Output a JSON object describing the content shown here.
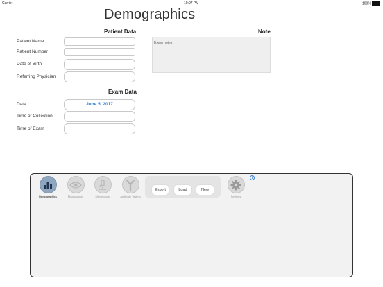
{
  "status_bar": {
    "carrier": "Carrier",
    "time": "10:07 PM",
    "battery": "100%"
  },
  "page_title": "Demographics",
  "patient_data": {
    "heading": "Patient Data",
    "fields": [
      {
        "label": "Patient Name",
        "value": ""
      },
      {
        "label": "Patient Number",
        "value": ""
      },
      {
        "label": "Date of Birth",
        "value": ""
      },
      {
        "label": "Referring Physician",
        "value": ""
      }
    ]
  },
  "exam_data": {
    "heading": "Exam Data",
    "fields": [
      {
        "label": "Date",
        "value": "June 5, 2017"
      },
      {
        "label": "Time of Collection",
        "value": ""
      },
      {
        "label": "Time of Exam",
        "value": ""
      }
    ]
  },
  "note": {
    "heading": "Note",
    "placeholder": "Exam notes"
  },
  "toolbar": {
    "tools": [
      {
        "label": "Demographics",
        "icon": "bar-chart-icon",
        "active": true
      },
      {
        "label": "Macroscopic",
        "icon": "eye-icon",
        "active": false
      },
      {
        "label": "Microscopic",
        "icon": "microscope-icon",
        "active": false
      },
      {
        "label": "Antibody Testing",
        "icon": "antibody-icon",
        "active": false
      }
    ],
    "actions": {
      "export": "Export",
      "load": "Load",
      "new": "New"
    },
    "settings_label": "Settings",
    "info_glyph": "i"
  },
  "colors": {
    "accent": "#2f80d1",
    "active_tool": "#8fa6bf",
    "panel_bg": "#f2f2f2"
  }
}
